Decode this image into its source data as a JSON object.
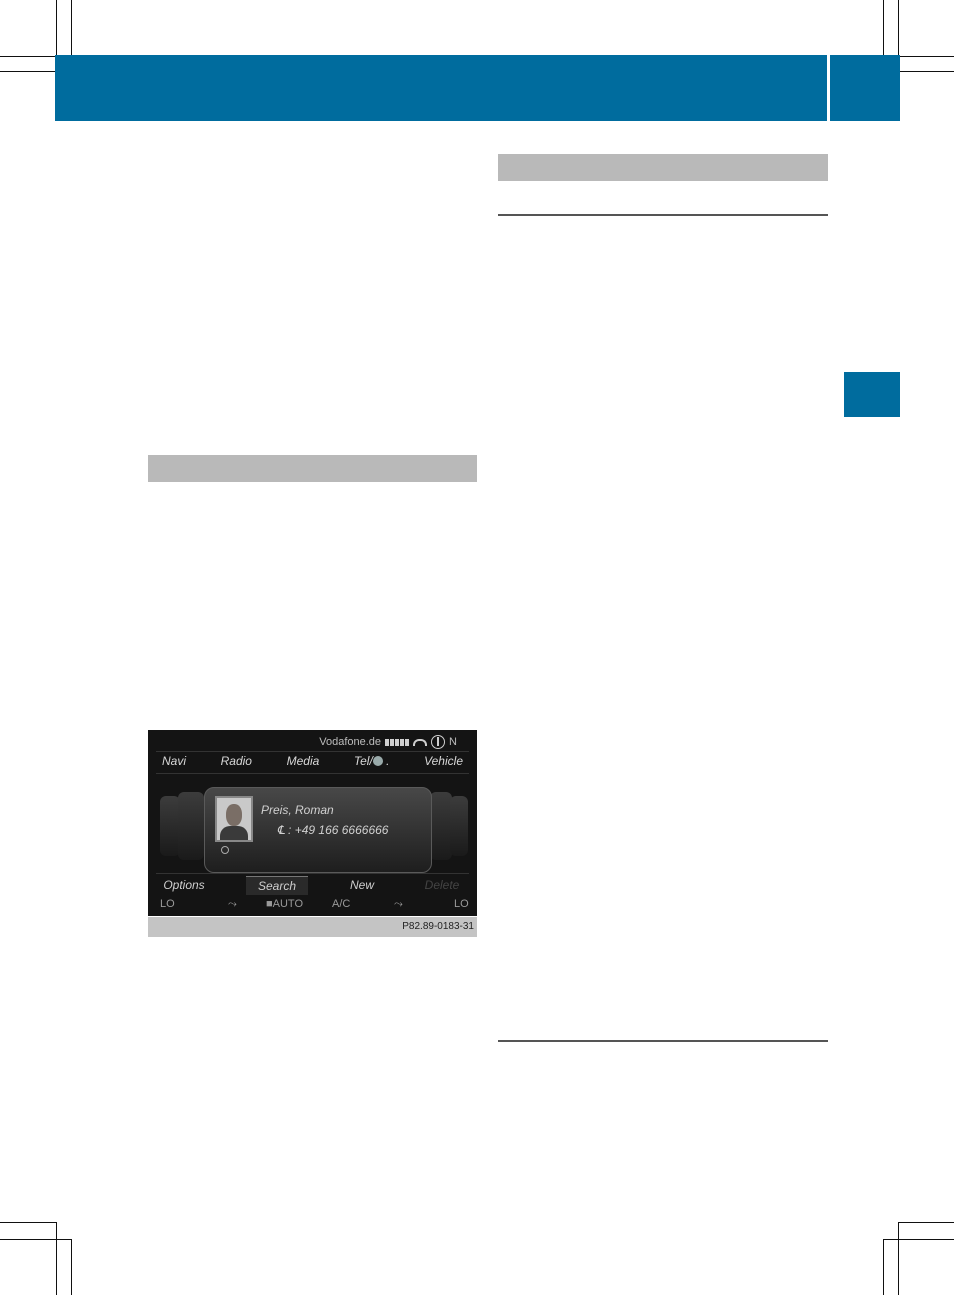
{
  "screen": {
    "status": {
      "carrier": "Vodafone.de",
      "compass_dir": "N"
    },
    "menu": [
      "Navi",
      "Radio",
      "Media",
      "Tel/",
      "Vehicle"
    ],
    "contact": {
      "name": "Preis, Roman",
      "number": "℄ : +49 166 6666666"
    },
    "softkeys": {
      "options": "Options",
      "search": "Search",
      "new": "New",
      "delete": "Delete"
    },
    "climate": {
      "left_temp": "LO",
      "auto": "AUTO",
      "ac": "A/C",
      "right_temp": "LO"
    }
  },
  "figure_id": "P82.89-0183-31",
  "colors": {
    "accent": "#006c9e",
    "section_bar": "#b9b9b9"
  }
}
